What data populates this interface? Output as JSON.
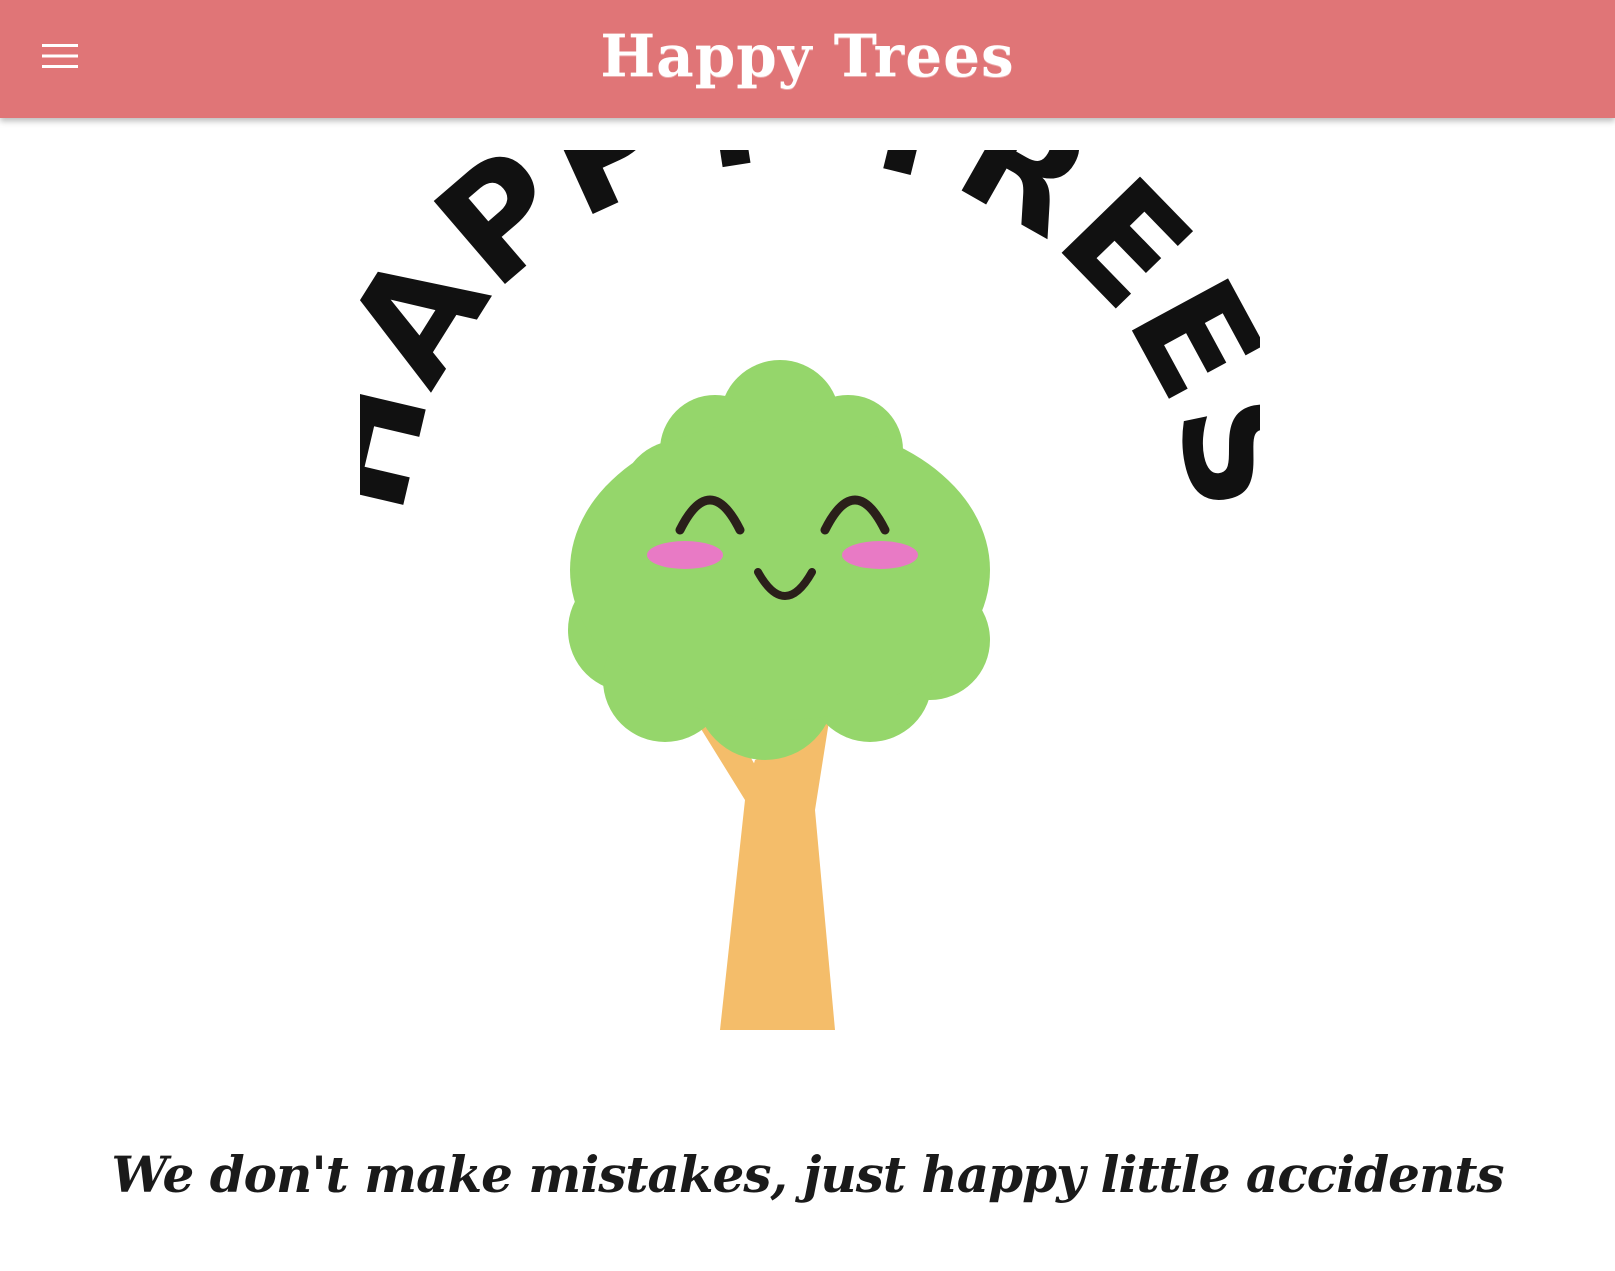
{
  "header": {
    "title": "Happy Trees",
    "menu_icon": "hamburger-menu-icon",
    "background_color": "#e07577"
  },
  "hero": {
    "logo_text": "HAPPY TREES",
    "image": "happy-tree-cartoon",
    "foliage_color": "#95d66b",
    "trunk_color": "#f4bd6a",
    "blush_color": "#e87ac5"
  },
  "tagline": "We don't make mistakes, just happy little accidents"
}
